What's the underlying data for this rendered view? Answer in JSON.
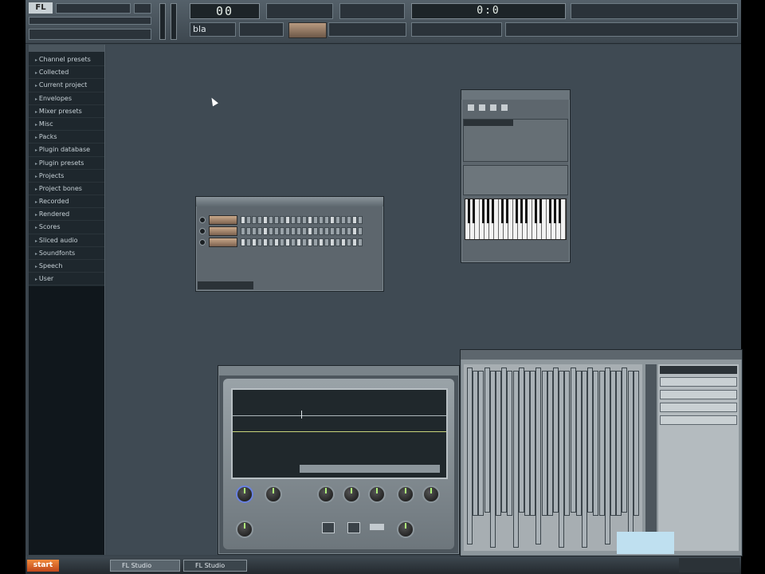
{
  "toolbar": {
    "menu_logo": "FL",
    "song_title": "",
    "tempo_display": "00",
    "time_display": "0:0",
    "hint_display": "",
    "pattern_label": "",
    "tool_label": "bla"
  },
  "browser": {
    "items": [
      "Channel presets",
      "Collected",
      "Current project",
      "Envelopes",
      "Mixer presets",
      "Misc",
      "Packs",
      "Plugin database",
      "Plugin presets",
      "Projects",
      "Project bones",
      "Recorded",
      "Rendered",
      "Scores",
      "Sliced audio",
      "Soundfonts",
      "Speech",
      "User"
    ]
  },
  "step_sequencer": {
    "title": "",
    "channels": [
      {
        "name": "",
        "steps": [
          1,
          0,
          0,
          0,
          1,
          0,
          0,
          0,
          1,
          0,
          0,
          0,
          1,
          0,
          0,
          0,
          1,
          0,
          0,
          0,
          1,
          0
        ]
      },
      {
        "name": "",
        "steps": [
          0,
          0,
          0,
          0,
          1,
          0,
          0,
          0,
          0,
          0,
          0,
          0,
          1,
          0,
          0,
          0,
          0,
          0,
          0,
          0,
          1,
          0
        ]
      },
      {
        "name": "",
        "steps": [
          1,
          0,
          1,
          0,
          1,
          0,
          1,
          0,
          1,
          0,
          1,
          0,
          1,
          0,
          1,
          0,
          1,
          0,
          1,
          0,
          1,
          0
        ]
      }
    ]
  },
  "piano_roll_window": {
    "title": "",
    "section_label": ""
  },
  "plugin_window": {
    "title": ""
  },
  "mixer_window": {
    "title": ""
  },
  "taskbar": {
    "start_label": "start",
    "tasks": [
      "FL Studio",
      "FL Studio"
    ]
  },
  "colors": {
    "workspace": "#3f4a53",
    "accent": "#f08a3c",
    "knob_ring": "#8c969c",
    "knob_ring_blue": "#6a82e0"
  }
}
